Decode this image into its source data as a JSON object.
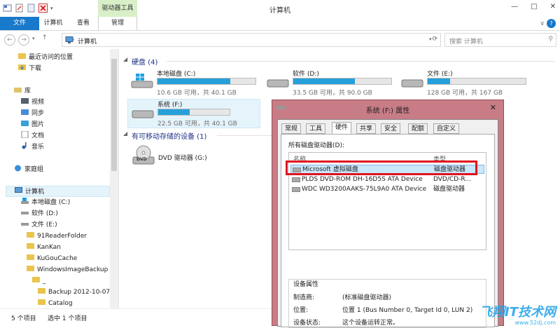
{
  "window": {
    "title": "计算机",
    "context_tab": "驱动器工具"
  },
  "ribbon": {
    "file": "文件",
    "computer": "计算机",
    "view": "查看",
    "manage": "管理"
  },
  "address": {
    "path": "计算机",
    "search_placeholder": "搜索 计算机"
  },
  "nav": {
    "recent": "最近访问的位置",
    "downloads": "下载",
    "libraries": "库",
    "videos": "视频",
    "sync": "同步",
    "pictures": "图片",
    "documents": "文档",
    "music": "音乐",
    "homegroup": "家庭组",
    "computer": "计算机",
    "local_c": "本地磁盘 (C:)",
    "soft_d": "软件 (D:)",
    "files_e": "文件 (E:)",
    "f1": "91ReaderFolder",
    "f2": "KanKan",
    "f3": "KuGouCache",
    "f4": "WindowsImageBackup",
    "f5": "Backup 2012-10-07",
    "f6": "Catalog",
    "f7": "_"
  },
  "content": {
    "hdd_group": "硬盘 (4)",
    "removable_group": "有可移动存储的设备 (1)",
    "drives": [
      {
        "name": "本地磁盘 (C:)",
        "usage": "10.6 GB 可用，共 40.1 GB",
        "used_fraction": 0.74
      },
      {
        "name": "软件 (D:)",
        "usage": "33.5 GB 可用，共 90.0 GB",
        "used_fraction": 0.63
      },
      {
        "name": "文件 (E:)",
        "usage": "128 GB 可用，共 167 GB",
        "used_fraction": 0.23
      },
      {
        "name": "系统 (F:)",
        "usage": "22.5 GB 可用，共 40.1 GB",
        "used_fraction": 0.44
      }
    ],
    "dvd": "DVD 驱动器 (G:)",
    "dvd_label": "DVD"
  },
  "status": {
    "count": "5 个项目",
    "selected": "选中 1 个项目"
  },
  "dialog": {
    "title": "系统 (F:) 属性",
    "tabs": [
      "常规",
      "工具",
      "硬件",
      "共享",
      "安全",
      "配额",
      "自定义"
    ],
    "list_label": "所有磁盘驱动器(D):",
    "col_name": "名称",
    "col_type": "类型",
    "rows": [
      {
        "name": "Microsoft 虚拟磁盘",
        "type": "磁盘驱动器"
      },
      {
        "name": "PLDS DVD-ROM DH-16D5S ATA Device",
        "type": "DVD/CD-R..."
      },
      {
        "name": "WDC WD3200AAKS-75L9A0 ATA Device",
        "type": "磁盘驱动器"
      }
    ],
    "props_title": "设备属性",
    "manufacturer_label": "制造商:",
    "manufacturer": "(标准磁盘驱动器)",
    "location_label": "位置:",
    "location": "位置 1 (Bus Number 0, Target Id 0, LUN 2)",
    "status_label": "设备状态:",
    "status": "这个设备运转正常。"
  },
  "watermark": {
    "text": "飞翔IT技术网",
    "url": "www.52dj.com"
  }
}
